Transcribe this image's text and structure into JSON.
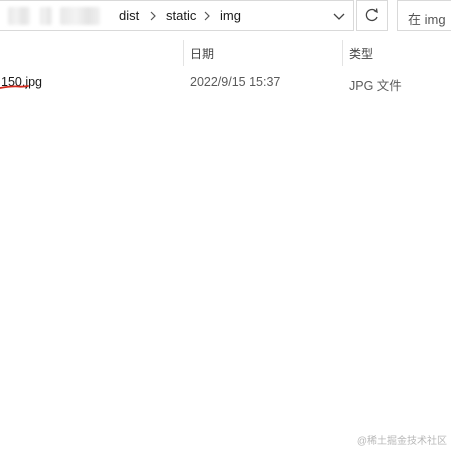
{
  "address_bar": {
    "breadcrumbs": [
      "dist",
      "static",
      "img"
    ],
    "dropdown_icon": "chevron-down-icon",
    "refresh_icon": "refresh-icon"
  },
  "search": {
    "placeholder": "在 img"
  },
  "columns": {
    "date": "日期",
    "type": "类型"
  },
  "files": [
    {
      "name": "150.jpg",
      "date": "2022/9/15 15:37",
      "type": "JPG 文件"
    }
  ],
  "watermark": "@稀土掘金技术社区",
  "colors": {
    "annotation_red": "#d42a1e",
    "border": "#d9d9d9"
  }
}
